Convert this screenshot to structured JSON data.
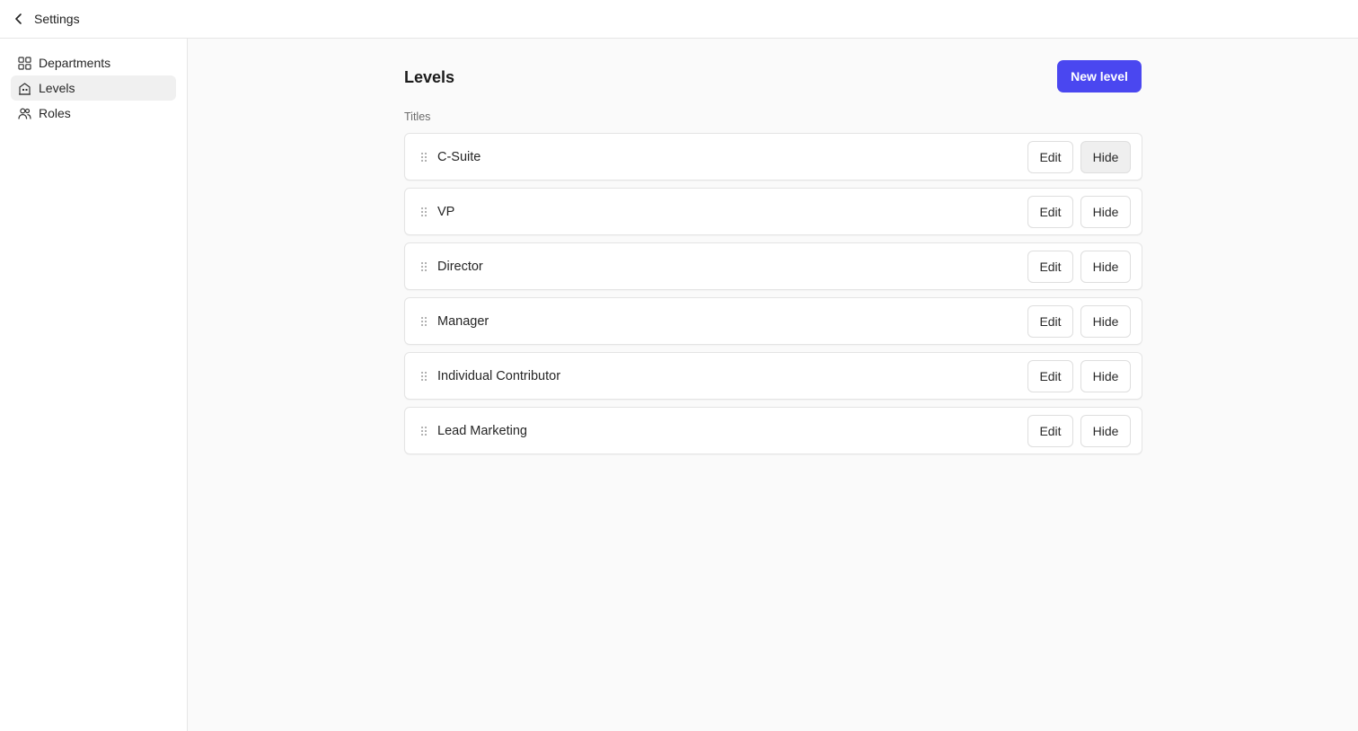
{
  "topbar": {
    "title": "Settings"
  },
  "sidebar": {
    "items": [
      {
        "label": "Departments",
        "icon": "grid-icon",
        "active": false
      },
      {
        "label": "Levels",
        "icon": "building-icon",
        "active": true
      },
      {
        "label": "Roles",
        "icon": "users-icon",
        "active": false
      }
    ]
  },
  "main": {
    "title": "Levels",
    "new_button_label": "New level",
    "section_label": "Titles",
    "rows": [
      {
        "label": "C-Suite",
        "edit": "Edit",
        "hide": "Hide"
      },
      {
        "label": "VP",
        "edit": "Edit",
        "hide": "Hide"
      },
      {
        "label": "Director",
        "edit": "Edit",
        "hide": "Hide"
      },
      {
        "label": "Manager",
        "edit": "Edit",
        "hide": "Hide"
      },
      {
        "label": "Individual Contributor",
        "edit": "Edit",
        "hide": "Hide"
      },
      {
        "label": "Lead Marketing",
        "edit": "Edit",
        "hide": "Hide"
      }
    ]
  },
  "colors": {
    "accent": "#4a47f0",
    "background": "#fafafa"
  }
}
